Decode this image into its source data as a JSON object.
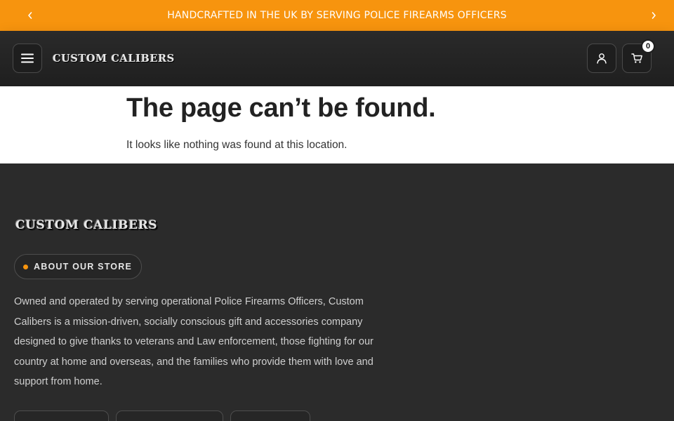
{
  "announcement": {
    "text": "HANDCRAFTED IN THE UK BY SERVING POLICE FIREARMS OFFICERS",
    "prev_icon": "chevron-left-icon",
    "next_icon": "chevron-right-icon"
  },
  "header": {
    "logo_text": "CUSTOM CALIBERS",
    "menu_icon": "hamburger-icon",
    "account_icon": "user-icon",
    "cart_icon": "cart-icon",
    "cart_count": "0"
  },
  "main": {
    "title": "The page can’t be found.",
    "subtitle": "It looks like nothing was found at this location."
  },
  "footer": {
    "logo_text": "CUSTOM CALIBERS",
    "about_label": "ABOUT OUR STORE",
    "description": "Owned and operated by serving operational Police Firearms Officers, Custom Calibers is a mission-driven, socially conscious gift and accessories company designed to give thanks to veterans and Law enforcement, those fighting for our country at home and overseas, and the families who provide them with love and support from home."
  },
  "colors": {
    "accent": "#f7940e",
    "header_bg": "#222222",
    "footer_bg": "#2b2b2b",
    "page_bg": "#ffffff"
  }
}
